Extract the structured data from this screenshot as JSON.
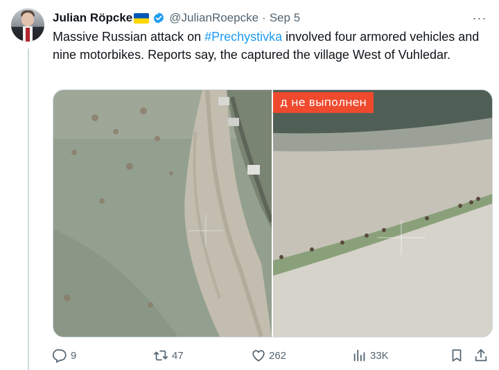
{
  "tweet": {
    "author_name": "Julian Röpcke",
    "handle": "@JulianRoepcke",
    "separator": "·",
    "time": "Sep 5",
    "more_label": "···",
    "text_before": "Massive Russian attack on ",
    "hashtag": "#Prechystivka",
    "text_after": " involved four armored vehicles and nine motorbikes. Reports say, the captured the village West of Vuhledar.",
    "media": {
      "right_overlay_text": "д не выполнен"
    },
    "actions": {
      "replies": "9",
      "reposts": "47",
      "likes": "262",
      "views": "33K"
    }
  },
  "colors": {
    "accent": "#1d9bf0",
    "muted": "#536471",
    "text": "#0f1419",
    "overlay": "#ef4a2e"
  },
  "icons": [
    "verified-badge-icon",
    "more-icon",
    "reply-icon",
    "repost-icon",
    "like-icon",
    "views-icon",
    "bookmark-icon",
    "share-icon"
  ]
}
